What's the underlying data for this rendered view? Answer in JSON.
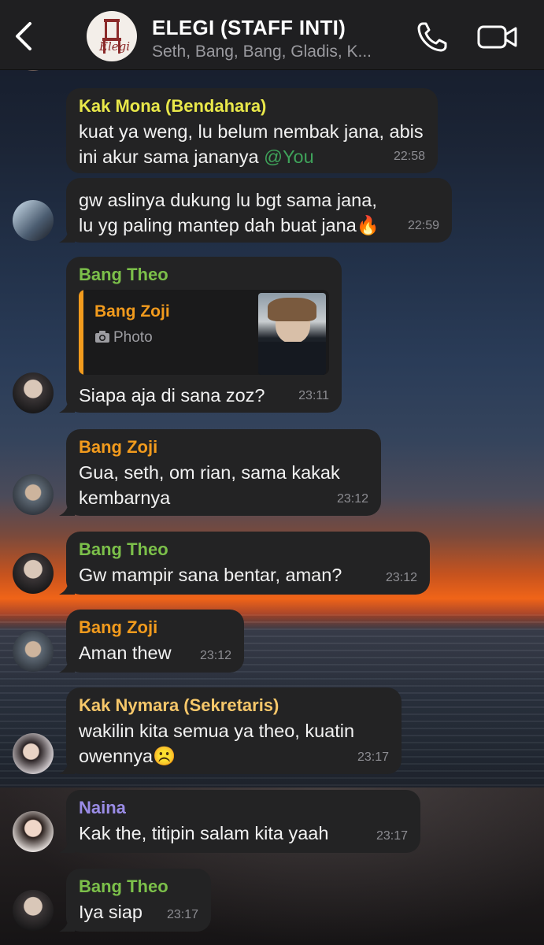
{
  "header": {
    "title": "ELEGI (STAFF INTI)",
    "subtitle": "Seth, Bang, Bang, Gladis, K...",
    "logo_text": "Elegi"
  },
  "colors": {
    "kak_mona": "#e9e84a",
    "bang_theo": "#7cc04a",
    "bang_zoji": "#f29b1d",
    "kak_nymara": "#f6c76a",
    "naina": "#9a8ce6",
    "mention": "#3fa35a"
  },
  "messages": [
    {
      "sender": "Kak Mona (Bendahara)",
      "text": "kuat ya weng, lu belum nembak jana, abis ini akur sama jananya",
      "mention": "@You",
      "time": "22:58"
    },
    {
      "sender": "",
      "text": "gw aslinya dukung lu bgt sama jana, lu yg paling mantep dah buat jana🔥",
      "time": "22:59"
    },
    {
      "sender": "Bang Theo",
      "reply": {
        "name": "Bang Zoji",
        "type": "Photo"
      },
      "text": "Siapa aja di sana zoz?",
      "time": "23:11"
    },
    {
      "sender": "Bang Zoji",
      "text": "Gua, seth, om rian, sama kakak kembarnya",
      "time": "23:12"
    },
    {
      "sender": "Bang Theo",
      "text": "Gw mampir sana bentar, aman?",
      "time": "23:12"
    },
    {
      "sender": "Bang Zoji",
      "text": "Aman thew",
      "time": "23:12"
    },
    {
      "sender": "Kak Nymara (Sekretaris)",
      "text": "wakilin kita semua ya theo, kuatin owennya☹️",
      "time": "23:17"
    },
    {
      "sender": "Naina",
      "text": "Kak the, titipin salam kita yaah",
      "time": "23:17"
    },
    {
      "sender": "Bang Theo",
      "text": "Iya siap",
      "time": "23:17"
    }
  ]
}
